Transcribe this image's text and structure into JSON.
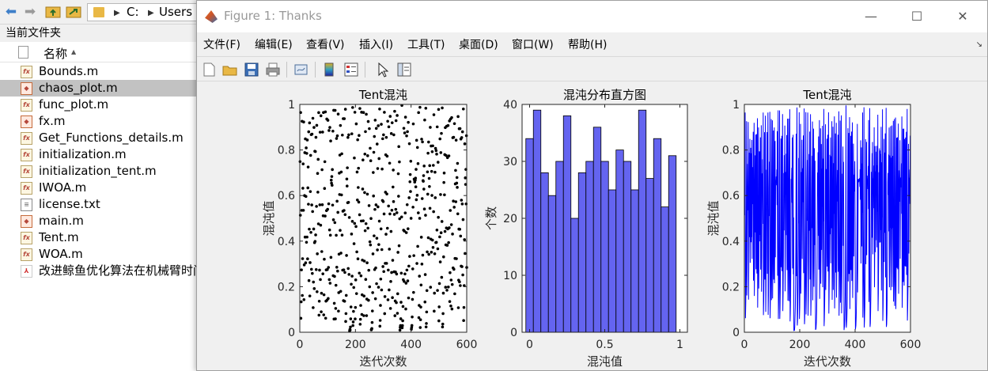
{
  "main_window": {
    "address": {
      "drive": "C:",
      "folder": "Users"
    },
    "current_folder_title": "当前文件夹",
    "file_column_header": "名称",
    "files": [
      {
        "name": "Bounds.m",
        "icon": "m-function-icon"
      },
      {
        "name": "chaos_plot.m",
        "icon": "m-script-icon",
        "selected": true
      },
      {
        "name": "func_plot.m",
        "icon": "m-function-icon"
      },
      {
        "name": "fx.m",
        "icon": "m-script-icon"
      },
      {
        "name": "Get_Functions_details.m",
        "icon": "m-function-icon"
      },
      {
        "name": "initialization.m",
        "icon": "m-function-icon"
      },
      {
        "name": "initialization_tent.m",
        "icon": "m-function-icon"
      },
      {
        "name": "IWOA.m",
        "icon": "m-function-icon"
      },
      {
        "name": "license.txt",
        "icon": "text-file-icon"
      },
      {
        "name": "main.m",
        "icon": "m-script-icon"
      },
      {
        "name": "Tent.m",
        "icon": "m-function-icon"
      },
      {
        "name": "WOA.m",
        "icon": "m-function-icon"
      },
      {
        "name": "改进鲸鱼优化算法在机械臂时间",
        "icon": "pdf-file-icon"
      }
    ]
  },
  "figure": {
    "title": "Figure 1: Thanks",
    "menu": [
      "文件(F)",
      "编辑(E)",
      "查看(V)",
      "插入(I)",
      "工具(T)",
      "桌面(D)",
      "窗口(W)",
      "帮助(H)"
    ],
    "toolbar": [
      "new-figure-icon",
      "open-file-icon",
      "save-icon",
      "print-icon",
      "link-plot-icon",
      "colorbar-icon",
      "legend-icon",
      "edit-plot-arrow-icon",
      "property-editor-icon"
    ]
  },
  "chart_data": [
    {
      "type": "scatter",
      "title": "Tent混沌",
      "xlabel": "迭代次数",
      "ylabel": "混沌值",
      "xlim": [
        0,
        600
      ],
      "ylim": [
        0,
        1
      ],
      "xticks": [
        0,
        200,
        400,
        600
      ],
      "yticks": [
        0,
        0.2,
        0.4,
        0.6,
        0.8,
        1
      ],
      "color": "#000000",
      "n_points": 600,
      "generator": "tent map x(k+1) = 2x(k) if x(k) < 0.5 else 2(1 - x(k)), random-like values spread over [0, 1]"
    },
    {
      "type": "bar",
      "title": "混沌分布直方图",
      "xlabel": "混沌值",
      "ylabel": "个数",
      "xlim": [
        -0.05,
        1.05
      ],
      "ylim": [
        0,
        40
      ],
      "xticks": [
        0,
        0.5,
        1
      ],
      "yticks": [
        0,
        10,
        20,
        30,
        40
      ],
      "color": "#6464f0",
      "bin_centers": [
        0,
        0.05,
        0.1,
        0.15,
        0.2,
        0.25,
        0.3,
        0.35,
        0.4,
        0.45,
        0.5,
        0.55,
        0.6,
        0.65,
        0.7,
        0.75,
        0.8,
        0.85,
        0.9,
        0.95,
        1
      ],
      "values": [
        34,
        39,
        28,
        24,
        30,
        38,
        20,
        28,
        30,
        36,
        30,
        25,
        32,
        30,
        25,
        39,
        27,
        34,
        22,
        31
      ]
    },
    {
      "type": "line",
      "title": "Tent混沌",
      "xlabel": "迭代次数",
      "ylabel": "混沌值",
      "xlim": [
        0,
        600
      ],
      "ylim": [
        0,
        1
      ],
      "xticks": [
        0,
        200,
        400,
        600
      ],
      "yticks": [
        0,
        0.2,
        0.4,
        0.6,
        0.8,
        1
      ],
      "color": "#0000ff",
      "n_points": 600,
      "generator": "same tent map sequence drawn as a connected line"
    }
  ]
}
